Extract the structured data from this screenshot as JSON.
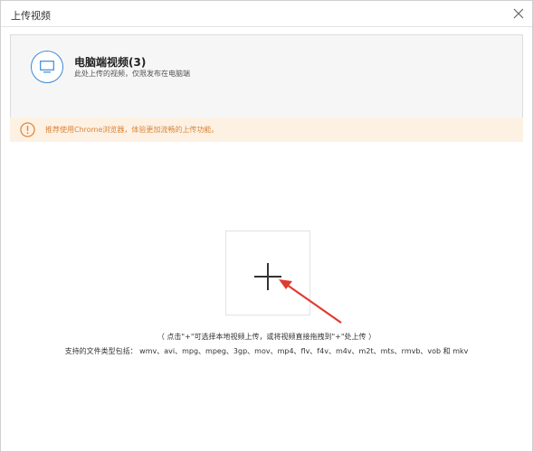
{
  "window": {
    "title": "上传视频"
  },
  "upload_type": {
    "name": "电脑端视频(3)",
    "description": "此处上传的视频，仅限发布在电脑端"
  },
  "notice": {
    "text": "推荐使用Chrome浏览器，体验更加流畅的上传功能。"
  },
  "upload": {
    "hint": "（ 点击\"+\"可选择本地视频上传，或将视频直接拖拽到\"+\"处上传 ）",
    "formats": "支持的文件类型包括： wmv、avi、mpg、mpeg、3gp、mov、mp4、flv、f4v、m4v、m2t、mts、rmvb、vob 和 mkv"
  },
  "icons": {
    "type": "monitor-icon",
    "notice": "warning-icon",
    "upload": "plus-icon",
    "close": "close-icon"
  },
  "colors": {
    "accent": "#3b8ad8",
    "notice_bg": "#fdf1e3",
    "notice_text": "#d9843a",
    "arrow": "#e03b2f"
  }
}
